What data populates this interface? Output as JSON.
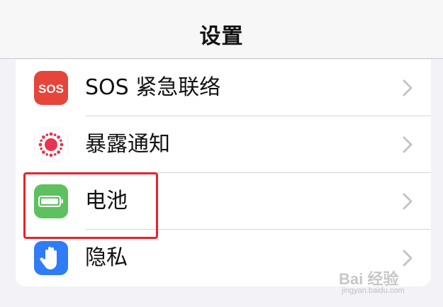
{
  "header": {
    "title": "设置"
  },
  "rows": [
    {
      "label": "SOS 紧急联络",
      "icon": "sos-icon",
      "icon_text": "SOS",
      "icon_color": "#e5453b"
    },
    {
      "label": "暴露通知",
      "icon": "exposure-notification-icon",
      "icon_color": "#e8344e"
    },
    {
      "label": "电池",
      "icon": "battery-icon",
      "icon_color": "#5cc15e"
    },
    {
      "label": "隐私",
      "icon": "privacy-hand-icon",
      "icon_color": "#2f7cf6"
    }
  ],
  "watermark": {
    "main": "Bai 经验",
    "sub": "jingyan.baidu.com"
  }
}
